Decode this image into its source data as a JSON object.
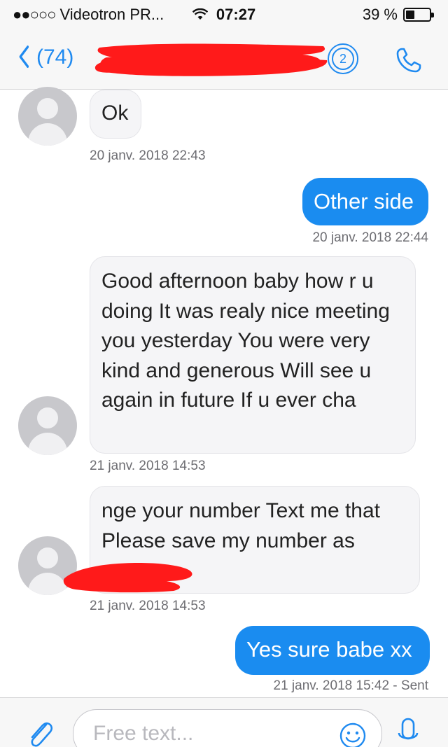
{
  "status_bar": {
    "signal": "●●○○○",
    "carrier": "Videotron PR...",
    "wifi_icon": "wifi-icon",
    "time": "07:27",
    "battery_text": "39 %",
    "battery_level": 0.39
  },
  "nav": {
    "back_label": "(74)",
    "thread_count": "2",
    "call_icon": "phone-icon"
  },
  "colors": {
    "accent": "#1f8af0",
    "outgoing_bubble": "#1a8cf0",
    "incoming_bubble": "#f5f5f7",
    "redaction": "#ff1a1a"
  },
  "messages": [
    {
      "direction": "incoming",
      "text": "Ok",
      "timestamp": "20 janv. 2018 22:43"
    },
    {
      "direction": "outgoing",
      "text": "Other side",
      "timestamp": "20 janv. 2018 22:44"
    },
    {
      "direction": "incoming",
      "text": "Good afternoon baby how r u doing It was realy nice meeting you yesterday You were very kind and generous Will see u again in future If u ever cha",
      "timestamp": "21 janv. 2018 14:53"
    },
    {
      "direction": "incoming",
      "text": "nge your number Text me that Please save my number as",
      "timestamp": "21 janv. 2018 14:53"
    },
    {
      "direction": "outgoing",
      "text": "Yes sure babe xx",
      "timestamp": "21 janv. 2018 15:42 - Sent"
    }
  ],
  "composer": {
    "placeholder": "Free text...",
    "attach_icon": "paperclip-icon",
    "emoji_icon": "smiley-icon",
    "mic_icon": "microphone-icon"
  }
}
